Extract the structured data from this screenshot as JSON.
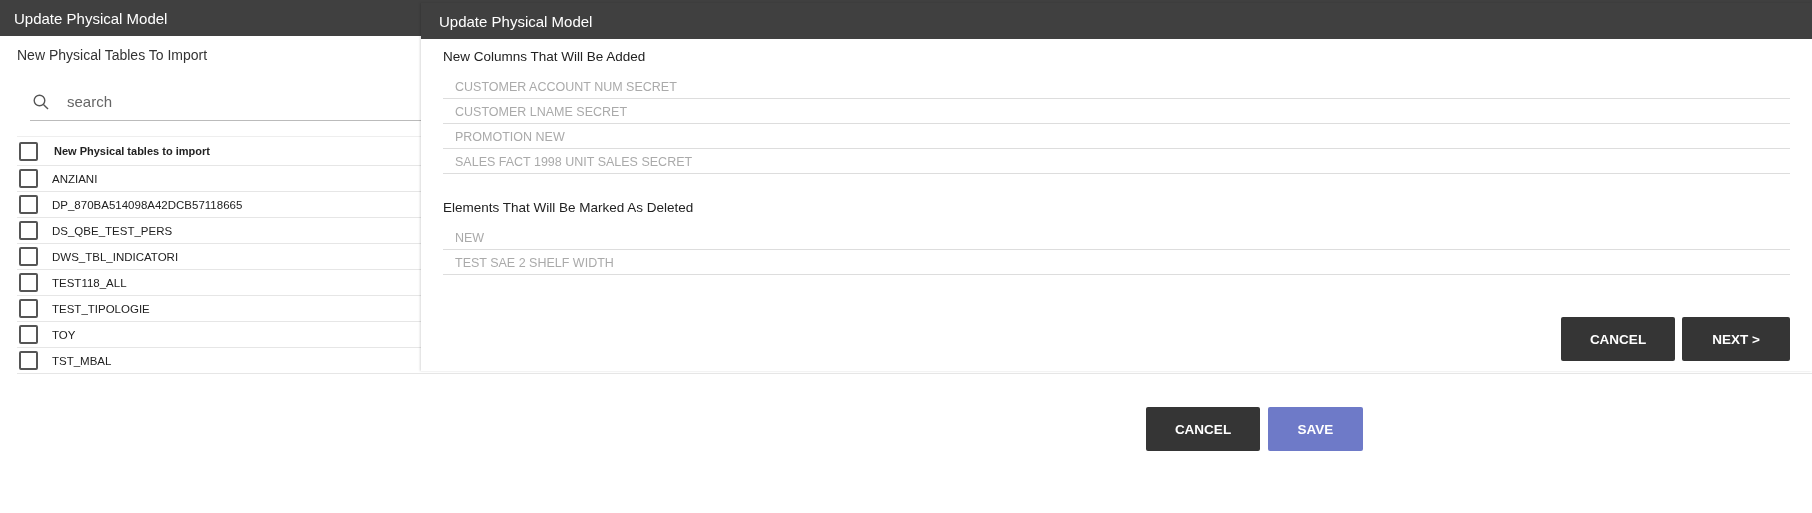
{
  "import_dialog": {
    "title": "Update Physical Model",
    "subtitle": "New Physical Tables To Import",
    "search": {
      "placeholder": "search"
    },
    "table": {
      "header": {
        "label": "New Physical tables to import",
        "checked": false
      },
      "rows": [
        {
          "name": "ANZIANI",
          "checked": false
        },
        {
          "name": "DP_870BA514098A42DCB57118665",
          "checked": false
        },
        {
          "name": "DS_QBE_TEST_PERS",
          "checked": false
        },
        {
          "name": "DWS_TBL_INDICATORI",
          "checked": false
        },
        {
          "name": "TEST118_ALL",
          "checked": false
        },
        {
          "name": "TEST_TIPOLOGIE",
          "checked": false
        },
        {
          "name": "TOY",
          "checked": false
        },
        {
          "name": "TST_MBAL",
          "checked": false
        }
      ]
    },
    "buttons": [
      {
        "label": "CANCEL",
        "kind": "dark"
      },
      {
        "label": "SAVE",
        "kind": "primary"
      }
    ]
  },
  "changes_dialog": {
    "title": "Update Physical Model",
    "sections": [
      {
        "heading": "New Columns That Will Be Added",
        "items": [
          "CUSTOMER ACCOUNT NUM SECRET",
          "CUSTOMER LNAME SECRET",
          "PROMOTION NEW",
          "SALES FACT 1998 UNIT SALES SECRET"
        ]
      },
      {
        "heading": "Elements That Will Be Marked As Deleted",
        "items": [
          "NEW",
          "TEST SAE 2 SHELF WIDTH"
        ]
      }
    ],
    "buttons": [
      {
        "label": "CANCEL",
        "kind": "dark"
      },
      {
        "label": "NEXT >",
        "kind": "dark"
      }
    ]
  }
}
